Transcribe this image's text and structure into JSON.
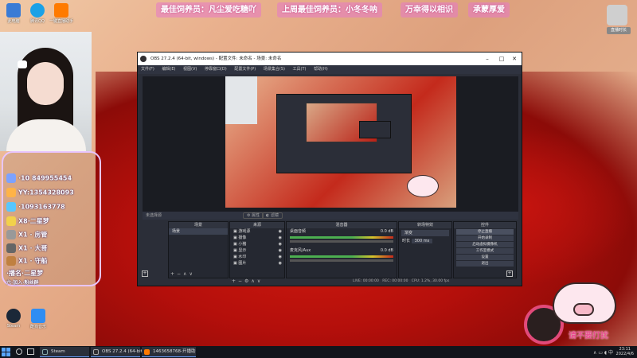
{
  "banners": [
    {
      "text": "最佳饲养员：凡尘爱吃糖吖"
    },
    {
      "text": "上周最佳饲养员：小冬冬呐"
    },
    {
      "text": "万幸得以相识"
    },
    {
      "text": "承蒙厚爱"
    }
  ],
  "desktop_icons": [
    {
      "label": "此电脑",
      "color": "#3a7bd5"
    },
    {
      "label": "腾讯QQ",
      "color": "#1aa1e6"
    },
    {
      "label": "一键直播助手",
      "color": "#ff7a00"
    },
    {
      "label": "Steam",
      "color": "#1b2838"
    },
    {
      "label": "酷狗音乐",
      "color": "#2f8df2"
    }
  ],
  "right_top_widget": {
    "label": "直播时长"
  },
  "gifts": [
    {
      "text": "·10 849955454",
      "color": "#7da2ff"
    },
    {
      "text": "YY:1354328093",
      "color": "#ffb347"
    },
    {
      "text": "·1093163778",
      "color": "#58c7ff"
    },
    {
      "text": "X8·二星梦",
      "color": "#f2d14b"
    },
    {
      "text": "X1 · 房管",
      "color": "#999"
    },
    {
      "text": "X1 · 大哥",
      "color": "#666"
    },
    {
      "text": "X1 · 守船",
      "color": "#c08040"
    },
    {
      "text": "·播名·二星梦",
      "color": "#e94c8d"
    },
    {
      "text": "六·加入·粉丝群",
      "color": "#b46cff"
    }
  ],
  "obs": {
    "title": "OBS 27.2.4 (64-bit, windows) - 配置文件: 未命名 - 场景: 未命名",
    "menu": [
      "文件(F)",
      "编辑(E)",
      "视图(V)",
      "停靠窗口(D)",
      "配置文件(P)",
      "场景集合(S)",
      "工具(T)",
      "帮助(H)"
    ],
    "source_label": "未选择源",
    "props_btn": "属性",
    "filter_btn": "滤镜",
    "panels": {
      "scenes": {
        "title": "场景",
        "items": [
          "场景"
        ]
      },
      "sources": {
        "title": "来源",
        "items": [
          "游戏源",
          "摄像",
          "小猪",
          "显示",
          "水印",
          "图片"
        ]
      },
      "mixer": {
        "title": "混音器",
        "tracks": [
          {
            "name": "桌面音频",
            "db": "0.0 dB"
          },
          {
            "name": "麦克风/Aux",
            "db": "0.0 dB"
          }
        ]
      },
      "transitions": {
        "title": "转场特效",
        "type": "渐变",
        "duration_label": "时长",
        "duration": "300 ms"
      },
      "controls": {
        "title": "控件",
        "buttons": [
          "停止直播",
          "开始录制",
          "启动虚拟摄像机",
          "工作室模式",
          "设置",
          "退出"
        ]
      }
    },
    "status": {
      "live": "LIVE: 00:00:00",
      "rec": "REC: 00:00:00",
      "cpu": "CPU: 1.2%, 30.00 fps"
    }
  },
  "sticker_text": "请不要打扰",
  "taskbar": {
    "tasks": [
      {
        "label": "Steam",
        "color": "#1b2838"
      },
      {
        "label": "OBS 27.2.4 (64-bit...",
        "color": "#302e31"
      },
      {
        "label": "1463658768-开播助",
        "color": "#ff7a00"
      }
    ],
    "time": "23:11",
    "date": "2022/4/6"
  }
}
